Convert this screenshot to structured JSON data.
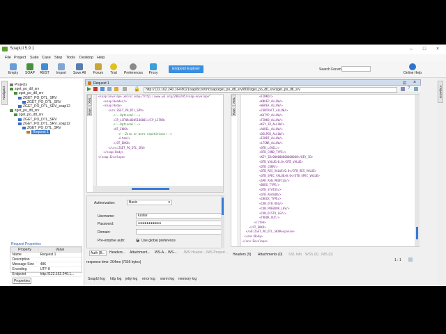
{
  "window": {
    "title": "SoapUI 5.9.1"
  },
  "menu": [
    "File",
    "Project",
    "Suite",
    "Case",
    "Step",
    "Tools",
    "Desktop",
    "Help"
  ],
  "toolbar": {
    "buttons": [
      "Empty",
      "SOAP",
      "REST",
      "Import",
      "Save All",
      "Forum",
      "Trial",
      "Preferences",
      "Proxy"
    ],
    "explorer": "Endpoint Explorer",
    "search_label": "Search Forum",
    "online_help": "Online Help"
  },
  "navigator": {
    "tab": "Navigator",
    "tree": [
      {
        "label": "Projects",
        "indent": 0,
        "color": "#777"
      },
      {
        "label": "zget_po_dtl_srv",
        "indent": 0,
        "color": "#4a8f3c"
      },
      {
        "label": "zget_po_dtl_srv",
        "indent": 1,
        "color": "#4a8f3c"
      },
      {
        "label": "ZGET_PO_DTL_SRV",
        "indent": 2,
        "color": "#3a6fc4"
      },
      {
        "label": "ZGET_PO_DTL_SRV",
        "indent": 3,
        "color": "#3a6fc4"
      },
      {
        "label": "ZGET_PO_DTL_SRV_soap12",
        "indent": 2,
        "color": "#3a6fc4"
      },
      {
        "label": "zget_po_dtl_srv",
        "indent": 0,
        "color": "#4a8f3c"
      },
      {
        "label": "zget_po_dtl_srv",
        "indent": 1,
        "color": "#4a8f3c"
      },
      {
        "label": "ZGET_PO_DTL_SRV",
        "indent": 2,
        "color": "#3a6fc4"
      },
      {
        "label": "ZGET_PO_DTL_SRV_soap12",
        "indent": 2,
        "color": "#3a6fc4"
      },
      {
        "label": "ZGET_PO_DTL_SRV",
        "indent": 3,
        "color": "#3a6fc4"
      },
      {
        "label": "Request 1",
        "indent": 4,
        "color": "#c47a2a",
        "selected": true
      }
    ]
  },
  "properties": {
    "title": "Request Properties",
    "headers": [
      "Property",
      "Value"
    ],
    "rows": [
      [
        "Name",
        "Request 1"
      ],
      [
        "Description",
        ""
      ],
      [
        "Message Size",
        "486"
      ],
      [
        "Encoding",
        "UTF-8"
      ],
      [
        "Endpoint",
        "http://122.162.240.1..."
      ]
    ],
    "button": "Properties"
  },
  "request": {
    "title": "Request 1",
    "url": "http://122.162.240.164:8021/sap/bc/srt/rfc/sap/zget_po_dtl_srv/800/zget_po_dtl_srv/zget_po_dtl_srv",
    "side_tabs": [
      "XML",
      "Raw"
    ],
    "lines": [
      "<soap:Envelope xmlns:soap=\"http://www.w3.org/2003/05/soap-envelope\"",
      "   <soap:Header/>",
      "   <soap:Body>",
      "      <urn:ZGET_PO_DTL_SRV>",
      "         <!--Optional:-->",
      "         <IP_LIFNR>0005100001</IP_LIFNR>",
      "         <!--Optional:-->",
      "         <OT_EKKO>",
      "            <!--Zero or more repetitions:-->",
      "            <item/>",
      "         </OT_EKKO>",
      "      </urn:ZGET_PO_DTL_SRV>",
      "   </soap:Body>",
      "</soap:Envelope>"
    ]
  },
  "auth": {
    "authorization_label": "Authorization:",
    "authorization_value": "Basic",
    "username_label": "Username:",
    "username_value": "kzafar",
    "password_label": "Password:",
    "password_value": "●●●●●●●●●●●",
    "domain_label": "Domain:",
    "domain_value": "",
    "preemptive_label": "Pre-emptive auth:",
    "preemptive_option": "Use global preference"
  },
  "request_tabs": [
    "Auth (B...",
    "Headers...",
    "Attachment...",
    "WS-A...",
    "WS-...",
    "JMS Header...",
    "JMS Propert..."
  ],
  "response": {
    "side_tabs": [
      "XML",
      "Raw"
    ],
    "lines": [
      "          <FINKO/>",
      "          <KNUEP_ALLOW/>",
      "          <WEREX_ALLOW/>",
      "          <CONTRACT_ALLOW/>",
      "          <KKTYP_ALLOW/>",
      "          <FINKO_ALLOW/>",
      "          <KEY_ID_ALLOW/>",
      "          <AUREL_ALLOW/>",
      "          <DELPER_ALLOW/>",
      "          <EINDT_ALLOW/>",
      "          <LTSNR_ALLOW/>",
      "          <OTB_LEVEL/>",
      "          <OTB_COND_TYPE/>",
      "          <KEY_ID>000000000000000</KEY_ID>",
      "          <OTB_VALUE>0.0</OTB_VALUE>",
      "          <OTB_CURR/>",
      "          <OTB_RES_VALUE>0.0</OTB_RES_VALUE>",
      "          <OTB_SPEC_VALUE>0.0</OTB_SPEC_VALUE>",
      "          <SPR_RSN_PROFILE/>",
      "          <BUDG_TYPE/>",
      "          <OTB_STATUS/>",
      "          <OTB_REASON/>",
      "          <CHECK_TYPE/>",
      "          <CON_OTB_REQ/>",
      "          <CON_PREBOOK_LEV/>",
      "          <CON_DISTR_LEV/>",
      "          <TRDOK_OUT/>",
      "       </item>",
      "    </OT_EKKO>",
      "  </n0:ZGET_PO_DTL_SRVResponse>",
      " </env:Body>",
      "</env:Envelope>"
    ]
  },
  "response_tabs": [
    "Headers (9)",
    "Attachments (0)",
    "SSL Info",
    "WSS (0)",
    "JMS (0)"
  ],
  "status": {
    "time": "response time: 264ms (7336 bytes)",
    "position": "1 : 1"
  },
  "log_tabs": [
    "SoapUI log",
    "http log",
    "jetty log",
    "error log",
    "wsrm log",
    "memory log"
  ],
  "right_strip": "Inspector",
  "colors": {
    "accent": "#3a8ee0",
    "xml_tag": "#7a2d8a",
    "xml_comment": "#2b7a2b",
    "selection": "#3c7fd4"
  }
}
